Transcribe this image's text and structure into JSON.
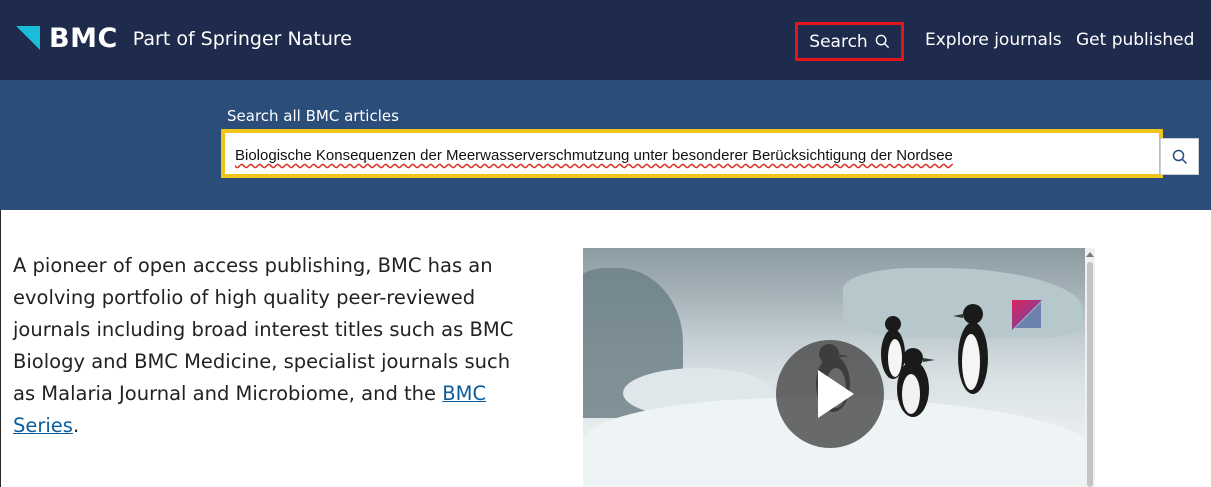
{
  "header": {
    "brand": "BMC",
    "tagline": "Part of Springer Nature",
    "nav": {
      "search_label": "Search",
      "explore_label": "Explore journals",
      "publish_label": "Get published"
    }
  },
  "search": {
    "label": "Search all BMC articles",
    "value": "Biologische Konsequenzen der Meerwasserverschmutzung unter besonderer Berücksichtigung der Nordsee"
  },
  "intro": {
    "text_before_link": "A pioneer of open access publishing, BMC has an evolving portfolio of high quality peer-reviewed journals including broad interest titles such as BMC Biology and BMC Medicine, specialist journals such as Malaria Journal and Microbiome, and the ",
    "link_text": "BMC Series",
    "text_after_link": "."
  },
  "colors": {
    "nav_bg": "#1e2b4d",
    "search_band_bg": "#2b4d7a",
    "highlight_red": "#e8141b",
    "highlight_yellow": "#f0c419",
    "brand_accent": "#1abdd9",
    "link": "#0c5d9c"
  },
  "icons": {
    "nav_search": "search-icon",
    "search_submit": "search-icon",
    "video": "play-icon"
  }
}
